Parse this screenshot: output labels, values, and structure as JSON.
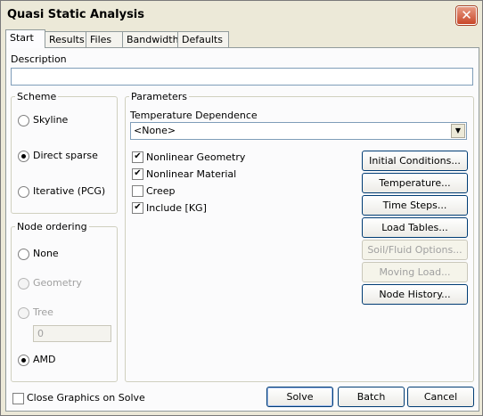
{
  "window": {
    "title": "Quasi Static Analysis",
    "close_glyph": "✕"
  },
  "tabs": [
    {
      "label": "Start"
    },
    {
      "label": "Results"
    },
    {
      "label": "Files"
    },
    {
      "label": "Bandwidth"
    },
    {
      "label": "Defaults"
    }
  ],
  "description": {
    "label": "Description",
    "value": ""
  },
  "scheme": {
    "title": "Scheme",
    "options": [
      {
        "label": "Skyline",
        "selected": false
      },
      {
        "label": "Direct sparse",
        "selected": true
      },
      {
        "label": "Iterative (PCG)",
        "selected": false
      }
    ]
  },
  "node_ordering": {
    "title": "Node ordering",
    "options": [
      {
        "label": "None",
        "selected": false,
        "enabled": true
      },
      {
        "label": "Geometry",
        "selected": false,
        "enabled": false
      },
      {
        "label": "Tree",
        "selected": false,
        "enabled": false
      },
      {
        "label": "AMD",
        "selected": true,
        "enabled": true
      }
    ],
    "tree_value": "0"
  },
  "parameters": {
    "title": "Parameters",
    "temperature_dependence_label": "Temperature Dependence",
    "temperature_dependence_value": "<None>",
    "checkboxes": [
      {
        "label": "Nonlinear Geometry",
        "checked": true
      },
      {
        "label": "Nonlinear Material",
        "checked": true
      },
      {
        "label": "Creep",
        "checked": false
      },
      {
        "label": "Include [KG]",
        "checked": true
      }
    ],
    "buttons": [
      {
        "label": "Initial Conditions...",
        "enabled": true
      },
      {
        "label": "Temperature...",
        "enabled": true
      },
      {
        "label": "Time Steps...",
        "enabled": true
      },
      {
        "label": "Load Tables...",
        "enabled": true
      },
      {
        "label": "Soil/Fluid Options...",
        "enabled": false
      },
      {
        "label": "Moving Load...",
        "enabled": false
      },
      {
        "label": "Node History...",
        "enabled": true
      }
    ]
  },
  "close_graphics": {
    "label": "Close Graphics on Solve",
    "checked": false
  },
  "footer": {
    "solve": "Solve",
    "batch": "Batch",
    "cancel": "Cancel"
  }
}
